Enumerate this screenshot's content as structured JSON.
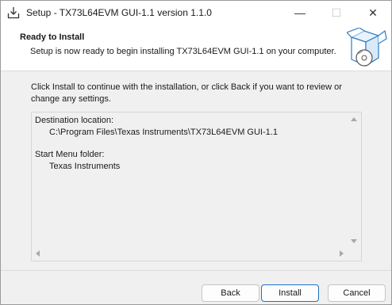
{
  "window": {
    "title": "Setup - TX73L64EVM GUI-1.1 version 1.1.0",
    "controls": {
      "minimize": "—",
      "maximize": "☐",
      "close": "✕"
    }
  },
  "header": {
    "title": "Ready to Install",
    "subtitle": "Setup is now ready to begin installing TX73L64EVM GUI-1.1 on your computer."
  },
  "body": {
    "intro": "Click Install to continue with the installation, or click Back if you want to review or change any settings.",
    "memo": {
      "destination_label": "Destination location:",
      "destination_value": "C:\\Program Files\\Texas Instruments\\TX73L64EVM GUI-1.1",
      "start_menu_label": "Start Menu folder:",
      "start_menu_value": "Texas Instruments"
    }
  },
  "buttons": {
    "back": "Back",
    "install": "Install",
    "cancel": "Cancel"
  },
  "colors": {
    "accent": "#1f6fc8",
    "background": "#f0f0f0",
    "header_bg": "#ffffff"
  }
}
